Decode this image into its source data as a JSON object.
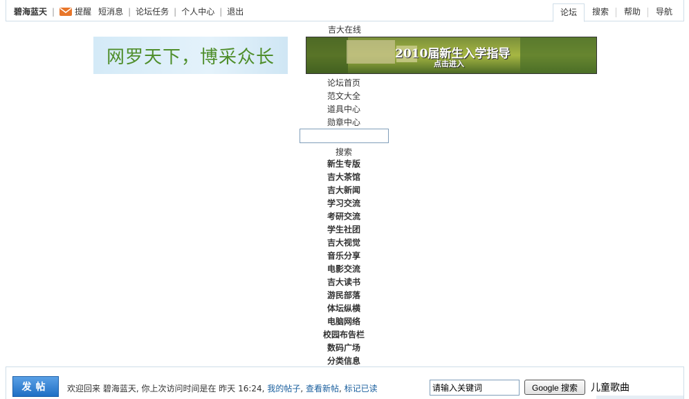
{
  "topbar": {
    "username": "碧海蓝天",
    "links": [
      "提醒",
      "短消息",
      "论坛任务",
      "个人中心",
      "退出"
    ],
    "tabs": [
      "论坛",
      "搜索",
      "帮助",
      "导航"
    ]
  },
  "site_name": "吉大在线",
  "banners": {
    "left_text": "网罗天下，博采众长",
    "right_title": "2010届新生入学指导",
    "right_sub": "点击进入"
  },
  "menu": [
    "论坛首页",
    "范文大全",
    "道具中心",
    "勋章中心"
  ],
  "search_label": "搜索",
  "forums": [
    "新生专版",
    "吉大茶馆",
    "吉大新闻",
    "学习交流",
    "考研交流",
    "学生社团",
    "吉大视觉",
    "音乐分享",
    "电影交流",
    "吉大读书",
    "游民部落",
    "体坛纵横",
    "电脑网络",
    "校园布告栏",
    "数码广场",
    "分类信息"
  ],
  "bottombar": {
    "post_label": "发帖",
    "welcome_prefix": "欢迎回来 碧海蓝天, 你上次访问时间是在 昨天 16:24,",
    "my_posts": "我的帖子",
    "new_posts": "查看新帖",
    "mark_read": "标记已读",
    "keyword_value": "请输入关键词",
    "google_label": "Google 搜索",
    "song_text": "儿童歌曲"
  },
  "colors": {
    "link": "#1a5f9e",
    "border": "#cfdde8",
    "post_button": "#2a7fd4"
  }
}
